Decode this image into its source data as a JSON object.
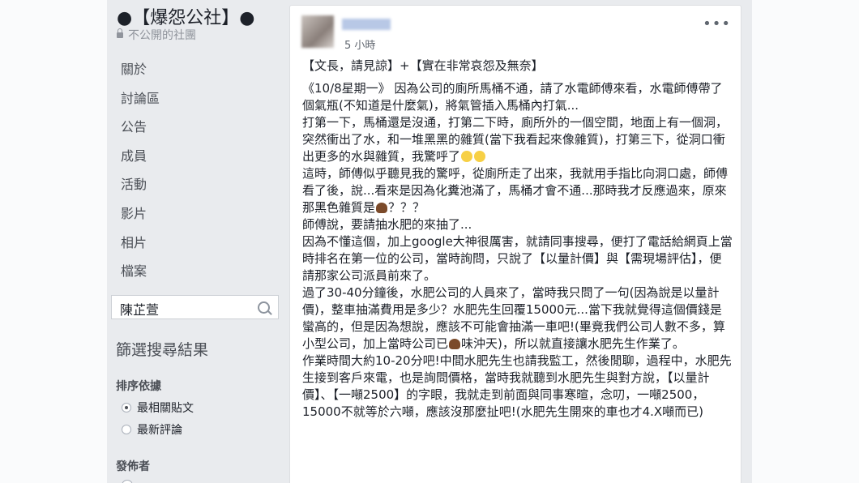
{
  "group": {
    "name": "●【爆怨公社】●",
    "privacy": "不公開的社團"
  },
  "nav": [
    "關於",
    "討論區",
    "公告",
    "成員",
    "活動",
    "影片",
    "相片",
    "檔案"
  ],
  "search": {
    "value": "陳芷萱"
  },
  "filter": {
    "title": "篩選搜尋結果",
    "sort_title": "排序依據",
    "options": [
      "最相關貼文",
      "最新評論"
    ],
    "selected": "最相關貼文",
    "author_title": "發佈者"
  },
  "post": {
    "time": "5 小時",
    "menu": "•••",
    "title": "【文長，請見諒】+【實在非常哀怨及無奈】",
    "lines": [
      "《10/8星期一》 因為公司的廁所馬桶不通，請了水電師傅來看，水電師傅帶了個氣瓶(不知道是什麼氣)，將氣管插入馬桶內打氣...",
      "打第一下，馬桶還是沒通，打第二下時，廁所外的一個空間，地面上有一個洞，突然衝出了水，和一堆黑黑的雜質(當下我看起來像雜質)，打第三下，從洞口衝出更多的水與雜質，我驚呼了",
      "這時，師傅似乎聽見我的驚呼，從廁所走了出來，我就用手指比向洞口處，師傅看了後，說...看來是因為化糞池滿了，馬桶才會不通...那時我才反應過來，原來那黑色雜質是",
      "師傅說，要請抽水肥的來抽了...",
      "因為不懂這個，加上google大神很厲害，就請同事搜尋，便打了電話給網頁上當時排名在第一位的公司，當時詢問，只說了【以量計價】與【需現場評估】，便請那家公司派員前來了。",
      "過了30-40分鐘後，水肥公司的人員來了，當時我只問了一句(因為說是以量計價)，整車抽滿費用是多少？水肥先生回覆15000元...當下我就覺得這個價錢是蠻高的，但是因為想說，應該不可能會抽滿一車吧!(畢竟我們公司人數不多，算小型公司，加上當時公司已",
      "味沖天)，所以就直接讓水肥先生作業了。",
      "作業時間大約10-20分吧!中間水肥先生也請我監工，然後閒聊，過程中，水肥先生接到客戶來電，也是詢問價格，當時我就聽到水肥先生與對方說，【以量計價】、【一噸2500】的字眼，我就走到前面與同事寒暄，念叨，一噸2500，15000不就等於六噸，應該沒那麼扯吧!(水肥先生開來的車也才4.X噸而已)"
    ],
    "suffix_q": "？？？",
    "emoji_names": [
      "flushed-face-icon",
      "pile-of-poo-icon"
    ]
  }
}
